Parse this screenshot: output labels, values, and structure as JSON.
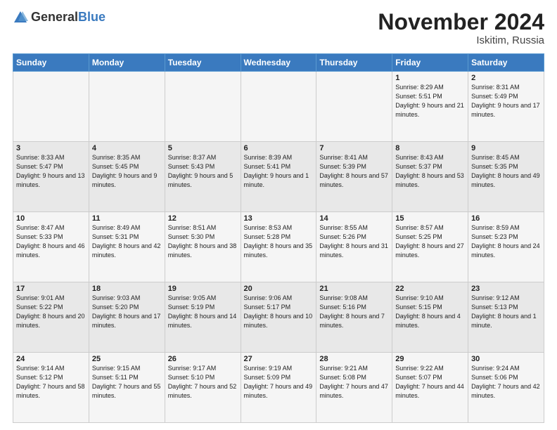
{
  "logo": {
    "general": "General",
    "blue": "Blue"
  },
  "title": "November 2024",
  "location": "Iskitim, Russia",
  "days_of_week": [
    "Sunday",
    "Monday",
    "Tuesday",
    "Wednesday",
    "Thursday",
    "Friday",
    "Saturday"
  ],
  "weeks": [
    [
      {
        "num": "",
        "info": ""
      },
      {
        "num": "",
        "info": ""
      },
      {
        "num": "",
        "info": ""
      },
      {
        "num": "",
        "info": ""
      },
      {
        "num": "",
        "info": ""
      },
      {
        "num": "1",
        "info": "Sunrise: 8:29 AM\nSunset: 5:51 PM\nDaylight: 9 hours and 21 minutes."
      },
      {
        "num": "2",
        "info": "Sunrise: 8:31 AM\nSunset: 5:49 PM\nDaylight: 9 hours and 17 minutes."
      }
    ],
    [
      {
        "num": "3",
        "info": "Sunrise: 8:33 AM\nSunset: 5:47 PM\nDaylight: 9 hours and 13 minutes."
      },
      {
        "num": "4",
        "info": "Sunrise: 8:35 AM\nSunset: 5:45 PM\nDaylight: 9 hours and 9 minutes."
      },
      {
        "num": "5",
        "info": "Sunrise: 8:37 AM\nSunset: 5:43 PM\nDaylight: 9 hours and 5 minutes."
      },
      {
        "num": "6",
        "info": "Sunrise: 8:39 AM\nSunset: 5:41 PM\nDaylight: 9 hours and 1 minute."
      },
      {
        "num": "7",
        "info": "Sunrise: 8:41 AM\nSunset: 5:39 PM\nDaylight: 8 hours and 57 minutes."
      },
      {
        "num": "8",
        "info": "Sunrise: 8:43 AM\nSunset: 5:37 PM\nDaylight: 8 hours and 53 minutes."
      },
      {
        "num": "9",
        "info": "Sunrise: 8:45 AM\nSunset: 5:35 PM\nDaylight: 8 hours and 49 minutes."
      }
    ],
    [
      {
        "num": "10",
        "info": "Sunrise: 8:47 AM\nSunset: 5:33 PM\nDaylight: 8 hours and 46 minutes."
      },
      {
        "num": "11",
        "info": "Sunrise: 8:49 AM\nSunset: 5:31 PM\nDaylight: 8 hours and 42 minutes."
      },
      {
        "num": "12",
        "info": "Sunrise: 8:51 AM\nSunset: 5:30 PM\nDaylight: 8 hours and 38 minutes."
      },
      {
        "num": "13",
        "info": "Sunrise: 8:53 AM\nSunset: 5:28 PM\nDaylight: 8 hours and 35 minutes."
      },
      {
        "num": "14",
        "info": "Sunrise: 8:55 AM\nSunset: 5:26 PM\nDaylight: 8 hours and 31 minutes."
      },
      {
        "num": "15",
        "info": "Sunrise: 8:57 AM\nSunset: 5:25 PM\nDaylight: 8 hours and 27 minutes."
      },
      {
        "num": "16",
        "info": "Sunrise: 8:59 AM\nSunset: 5:23 PM\nDaylight: 8 hours and 24 minutes."
      }
    ],
    [
      {
        "num": "17",
        "info": "Sunrise: 9:01 AM\nSunset: 5:22 PM\nDaylight: 8 hours and 20 minutes."
      },
      {
        "num": "18",
        "info": "Sunrise: 9:03 AM\nSunset: 5:20 PM\nDaylight: 8 hours and 17 minutes."
      },
      {
        "num": "19",
        "info": "Sunrise: 9:05 AM\nSunset: 5:19 PM\nDaylight: 8 hours and 14 minutes."
      },
      {
        "num": "20",
        "info": "Sunrise: 9:06 AM\nSunset: 5:17 PM\nDaylight: 8 hours and 10 minutes."
      },
      {
        "num": "21",
        "info": "Sunrise: 9:08 AM\nSunset: 5:16 PM\nDaylight: 8 hours and 7 minutes."
      },
      {
        "num": "22",
        "info": "Sunrise: 9:10 AM\nSunset: 5:15 PM\nDaylight: 8 hours and 4 minutes."
      },
      {
        "num": "23",
        "info": "Sunrise: 9:12 AM\nSunset: 5:13 PM\nDaylight: 8 hours and 1 minute."
      }
    ],
    [
      {
        "num": "24",
        "info": "Sunrise: 9:14 AM\nSunset: 5:12 PM\nDaylight: 7 hours and 58 minutes."
      },
      {
        "num": "25",
        "info": "Sunrise: 9:15 AM\nSunset: 5:11 PM\nDaylight: 7 hours and 55 minutes."
      },
      {
        "num": "26",
        "info": "Sunrise: 9:17 AM\nSunset: 5:10 PM\nDaylight: 7 hours and 52 minutes."
      },
      {
        "num": "27",
        "info": "Sunrise: 9:19 AM\nSunset: 5:09 PM\nDaylight: 7 hours and 49 minutes."
      },
      {
        "num": "28",
        "info": "Sunrise: 9:21 AM\nSunset: 5:08 PM\nDaylight: 7 hours and 47 minutes."
      },
      {
        "num": "29",
        "info": "Sunrise: 9:22 AM\nSunset: 5:07 PM\nDaylight: 7 hours and 44 minutes."
      },
      {
        "num": "30",
        "info": "Sunrise: 9:24 AM\nSunset: 5:06 PM\nDaylight: 7 hours and 42 minutes."
      }
    ]
  ]
}
